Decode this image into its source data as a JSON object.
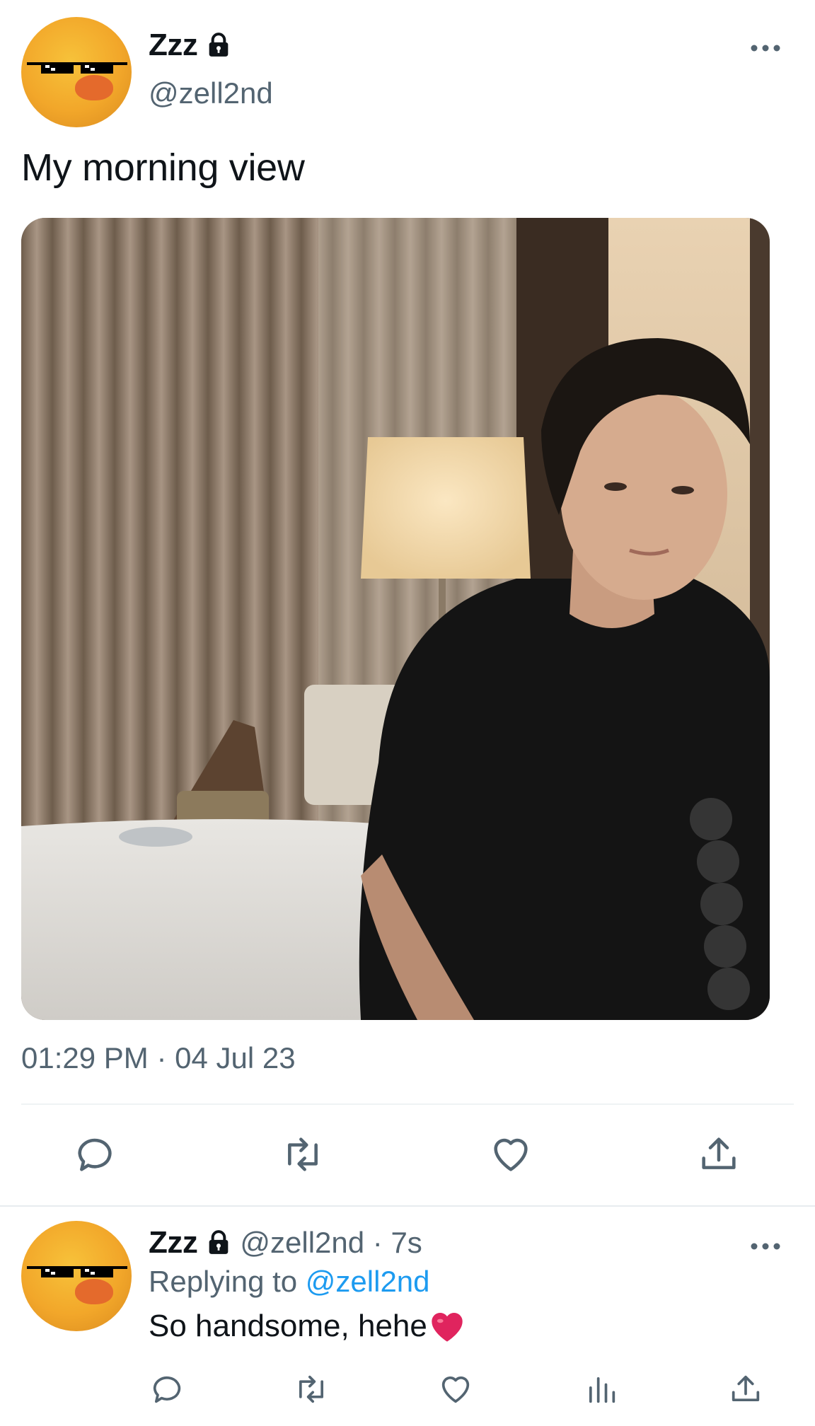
{
  "main_tweet": {
    "author": {
      "display_name": "Zzz",
      "handle": "@zell2nd",
      "avatar_icon": "duck-with-sunglasses-avatar",
      "verified_icon": "lock-icon"
    },
    "text": "My morning view",
    "media": {
      "description_icon": "photo",
      "alt": ""
    },
    "timestamp": "01:29 PM · 04 Jul 23",
    "actions": [
      {
        "name": "reply",
        "icon": "reply-icon"
      },
      {
        "name": "retweet",
        "icon": "retweet-icon"
      },
      {
        "name": "like",
        "icon": "heart-icon"
      },
      {
        "name": "share",
        "icon": "share-icon"
      }
    ]
  },
  "reply_tweet": {
    "author": {
      "display_name": "Zzz",
      "handle_time": "@zell2nd · 7s"
    },
    "replying_prefix": "Replying to",
    "replying_to": "@zell2nd",
    "text": "So handsome, hehe",
    "emoji": "red-heart",
    "actions": [
      {
        "name": "reply",
        "icon": "reply-icon"
      },
      {
        "name": "retweet",
        "icon": "retweet-icon"
      },
      {
        "name": "like",
        "icon": "heart-icon"
      },
      {
        "name": "views",
        "icon": "analytics-icon"
      },
      {
        "name": "share",
        "icon": "share-icon"
      }
    ]
  },
  "colors": {
    "text_primary": "#0f1419",
    "text_secondary": "#536471",
    "link": "#1d9bf0",
    "divider": "#eff3f4",
    "heart": "#e0245e"
  }
}
